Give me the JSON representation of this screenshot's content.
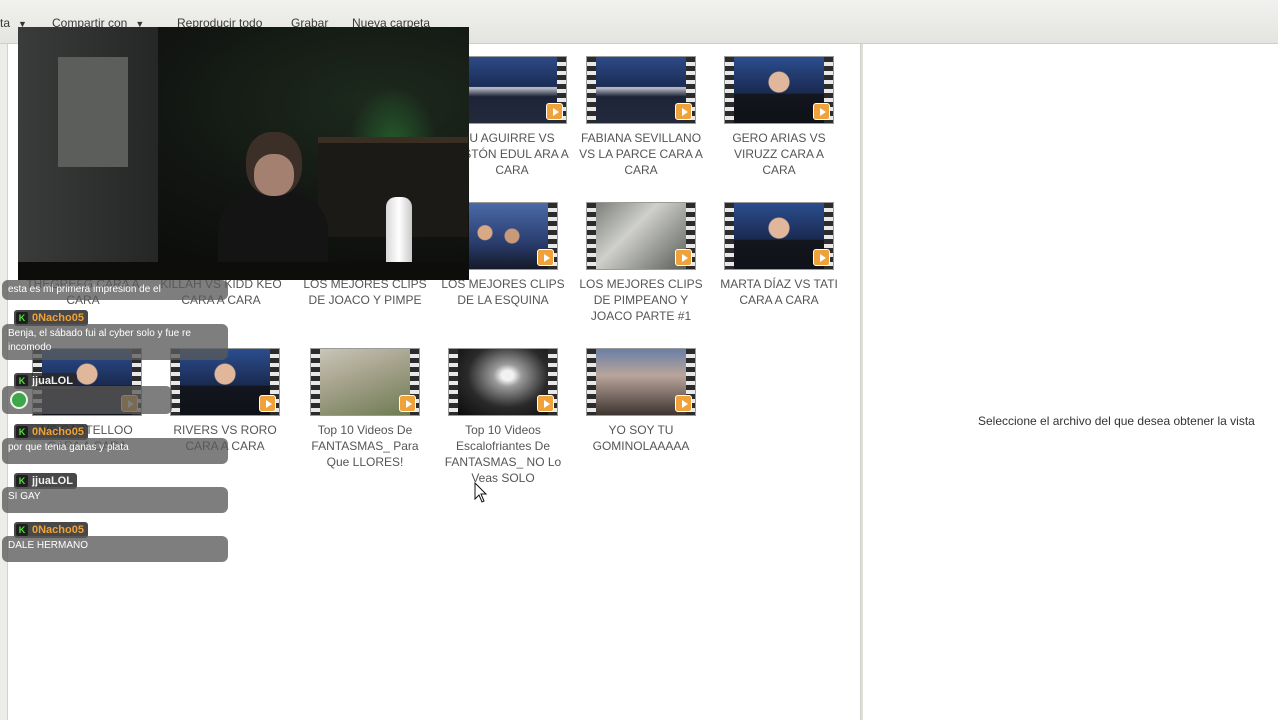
{
  "toolbar": {
    "item_organize": "ta",
    "item_share": "Compartir con",
    "item_play_all": "Reproducir todo",
    "item_burn": "Grabar",
    "item_new_folder": "Nueva carpeta"
  },
  "videos": [
    {
      "caption": "U AGUIRRE VS ASTÓN EDUL ARA A CARA",
      "thumb": "studio"
    },
    {
      "caption": "FABIANA SEVILLANO VS LA PARCE  CARA A CARA",
      "thumb": "studio"
    },
    {
      "caption": "GERO ARIAS VS VIRUZZ  CARA A CARA",
      "thumb": "person"
    },
    {
      "caption": "KILLAH VS KIDD KEO  CARA A CARA",
      "thumb": "studio"
    },
    {
      "caption": "LOS MEJORES CLIPS DE JOACO Y PIMPE",
      "thumb": "studio"
    },
    {
      "caption": "LOS MEJORES CLIPS DE LA ESQUINA",
      "thumb": "crowd"
    },
    {
      "caption": "LOS MEJORES CLIPS DE PIMPEANO Y JOACO  PARTE #1",
      "thumb": "room"
    },
    {
      "caption": "MARTA DÍAZ VS TATI  CARA A CARA",
      "thumb": "person"
    },
    {
      "caption": "VS CASTELLOO CARA A CARA",
      "thumb": "person"
    },
    {
      "caption": "RIVERS VS RORO CARA A CARA",
      "thumb": "person"
    },
    {
      "caption": "Top 10 Videos De FANTASMAS_ Para Que LLORES!",
      "thumb": "field"
    },
    {
      "caption": "Top 10 Videos Escalofriantes De FANTASMAS_ NO Lo Veas SOLO",
      "thumb": "dark"
    },
    {
      "caption": "YO SOY TU GOMINOLAAAAA",
      "thumb": "party"
    },
    {
      "caption": "THEGREFG  CARA A CARA",
      "thumb": "studio"
    }
  ],
  "preview": {
    "message": "Seleccione el archivo del que desea obtener la vista"
  },
  "chat": {
    "m1_text": "esta es mi primera impresion de el",
    "m2_user": "0Nacho05",
    "m2_text": "Benja, el sábado fui al cyber solo y fue re incomodo",
    "m3_user": "jjuaLOL",
    "m4_user": "0Nacho05",
    "m4_text": "por que tenia ganas y plata",
    "m5_user": "jjuaLOL",
    "m5_text": "SI GAY",
    "m6_user": "0Nacho05",
    "m6_text": "DALE HERMANO"
  },
  "colors": {
    "play_badge": "#f0a23a",
    "username_orange": "#f0a23a",
    "mod_badge_green": "#52e03d"
  }
}
